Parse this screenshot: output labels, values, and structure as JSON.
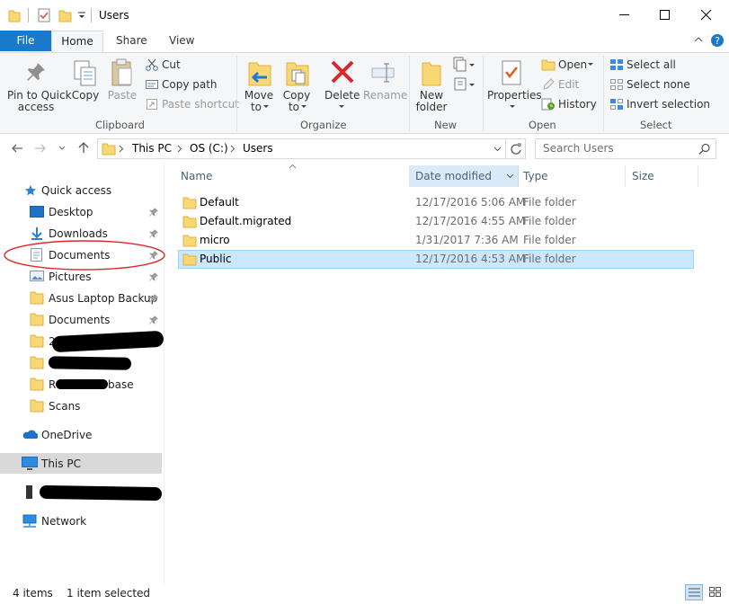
{
  "window": {
    "title": "Users"
  },
  "ribbon_tabs": [
    "File",
    "Home",
    "Share",
    "View"
  ],
  "ribbon": {
    "clipboard": {
      "label": "Clipboard",
      "pin": "Pin to Quick",
      "pin2": "access",
      "copy": "Copy",
      "paste": "Paste",
      "cut": "Cut",
      "copy_path": "Copy path",
      "paste_shortcut": "Paste shortcut"
    },
    "organize": {
      "label": "Organize",
      "move": "Move",
      "move2": "to",
      "copy": "Copy",
      "copy2": "to",
      "delete": "Delete",
      "rename": "Rename"
    },
    "new": {
      "label": "New",
      "new_folder": "New",
      "new_folder2": "folder"
    },
    "open": {
      "label": "Open",
      "properties": "Properties",
      "open": "Open",
      "edit": "Edit",
      "history": "History"
    },
    "select": {
      "label": "Select",
      "all": "Select all",
      "none": "Select none",
      "invert": "Invert selection"
    }
  },
  "address": {
    "crumbs": [
      "This PC",
      "OS (C:)",
      "Users"
    ],
    "search_placeholder": "Search Users"
  },
  "nav": {
    "quick_access": "Quick access",
    "items": [
      "Desktop",
      "Downloads",
      "Documents",
      "Pictures",
      "Asus Laptop Backup",
      "Documents",
      "Scans"
    ],
    "partial_a": "20",
    "partial_b": "R",
    "partial_b_tail": "base",
    "onedrive": "OneDrive",
    "this_pc": "This PC",
    "network": "Network"
  },
  "columns": [
    "Name",
    "Date modified",
    "Type",
    "Size"
  ],
  "files": [
    {
      "name": "Default",
      "date": "12/17/2016 5:06 AM",
      "type": "File folder"
    },
    {
      "name": "Default.migrated",
      "date": "12/17/2016 4:55 AM",
      "type": "File folder"
    },
    {
      "name": "micro",
      "date": "1/31/2017 7:36 AM",
      "type": "File folder"
    },
    {
      "name": "Public",
      "date": "12/17/2016 4:53 AM",
      "type": "File folder"
    }
  ],
  "status": {
    "count": "4 items",
    "selection": "1 item selected"
  },
  "colors": {
    "accent": "#1979ca",
    "selection": "#cce8ff",
    "annotation": "#e0282c"
  }
}
